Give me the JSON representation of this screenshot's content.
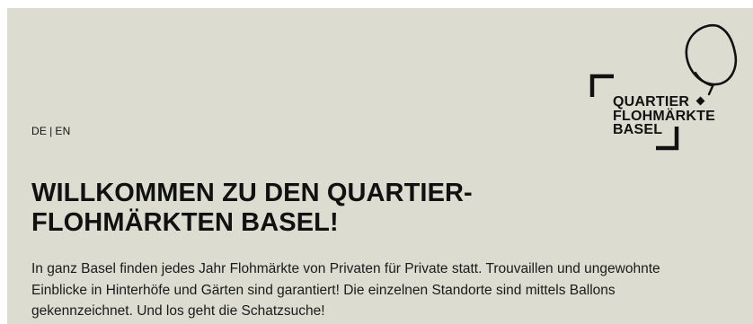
{
  "language_switch": {
    "de_label": "DE",
    "separator": "|",
    "en_label": "EN"
  },
  "logo": {
    "line1": "QUARTIER",
    "line2": "FLOHMÄRKTE",
    "line3": "BASEL",
    "icon": "balloon-icon"
  },
  "headline": {
    "line1": "WILLKOMMEN ZU DEN QUARTIER-",
    "line2": "FLOHMÄRKTEN BASEL!"
  },
  "intro_text": "In ganz Basel finden jedes Jahr Flohmärkte von Privaten für Private statt. Trouvaillen und ungewohnte Einblicke in Hinterhöfe und Gärten sind garantiert! Die einzelnen Standorte sind mittels Ballons gekennzeichnet. Und los geht die Schatzsuche!",
  "colors": {
    "background": "#dcddd0",
    "text": "#111111"
  }
}
